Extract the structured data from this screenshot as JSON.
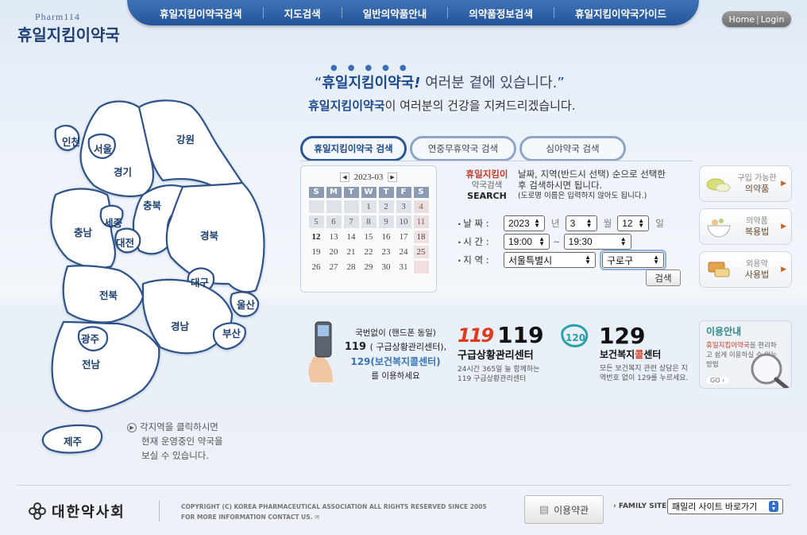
{
  "nav": {
    "items": [
      "휴일지킴이약국검색",
      "지도검색",
      "일반의약품안내",
      "의약품정보검색",
      "휴일지킴이약국가이드"
    ]
  },
  "logo": {
    "sub": "Pharm114",
    "main": "휴일지킴이약국"
  },
  "header": {
    "home": "Home",
    "divider": "|",
    "login": "Login"
  },
  "hero": {
    "line1_quote_open": "“",
    "line1_brand": "휴일지킴이약국",
    "line1_mark": "!",
    "line1_rest": " 여러분 곁에 있습니다.",
    "line1_quote_close": "”",
    "line2_brand": "휴일지킴이약국",
    "line2_rest": "이 여러분의 건강을 지켜드리겠습니다."
  },
  "map": {
    "regions": [
      "인천",
      "서울",
      "경기",
      "강원",
      "충북",
      "세종",
      "충남",
      "대전",
      "경북",
      "대구",
      "전북",
      "울산",
      "경남",
      "부산",
      "광주",
      "전남",
      "제주"
    ],
    "note": [
      "각지역을 클릭하시면",
      "현재 운영중인 약국을",
      "보실 수 있습니다."
    ]
  },
  "tabs": [
    "휴일지킴이약국 검색",
    "연중무휴약국 검색",
    "심야약국 검색"
  ],
  "calendar": {
    "title": "2023-03",
    "prev": "◀",
    "next": "▶",
    "days_of_week": [
      "S",
      "M",
      "T",
      "W",
      "T",
      "F",
      "S"
    ],
    "rows": [
      [
        "",
        "",
        "",
        "1",
        "2",
        "3",
        "4"
      ],
      [
        "5",
        "6",
        "7",
        "8",
        "9",
        "10",
        "11"
      ],
      [
        "12",
        "13",
        "14",
        "15",
        "16",
        "17",
        "18"
      ],
      [
        "19",
        "20",
        "21",
        "22",
        "23",
        "24",
        "25"
      ],
      [
        "26",
        "27",
        "28",
        "29",
        "30",
        "31",
        ""
      ]
    ],
    "today": "12"
  },
  "search": {
    "logo": [
      "휴일지킴이",
      "약국검색",
      "SEARCH"
    ],
    "desc": "날짜, 지역(반드시 선택) 순으로 선택한 후 검색하시면 됩니다.",
    "desc_small": "(도로명 이름은 입력하지 않아도 됩니다.)",
    "date_label": "날 짜 :",
    "year": "2023",
    "year_unit": "년",
    "month": "3",
    "month_unit": "월",
    "day": "12",
    "day_unit": "일",
    "time_label": "시 간 :",
    "time_from": "19:00",
    "time_tilde": "~",
    "time_to": "19:30",
    "region_label": "지 역 :",
    "city": "서울특별시",
    "district": "구로구",
    "button": "검색"
  },
  "side": [
    {
      "small": "구입 가능한",
      "main": "의약품"
    },
    {
      "small": "의약품",
      "main": "복용법"
    },
    {
      "small": "외용약",
      "main": "사용법"
    }
  ],
  "info": {
    "phone": {
      "t1": "국번없이 (핸드폰 동일)",
      "t2a": "119",
      "t2b": "( 구급상황관리센터),",
      "t3": "129(보건복지콜센터)",
      "t4": "를 이용하세요"
    },
    "c119": {
      "logo": "119",
      "num": "119",
      "title": "구급상황관리센터",
      "desc": "24시간 365일 늘 함께하는 119 구급상황관리센터"
    },
    "c129": {
      "logo": "120",
      "num": "129",
      "title_a": "보건복지",
      "title_b": "콜",
      "title_c": "센터",
      "desc": "모든 보건복지 관련 상담은 지역번호 없이 129를 누르세요."
    },
    "usage": {
      "title": "이용안내",
      "brand": "휴일지킴이약국",
      "body": "을 편리하고 쉽게 이용하실 수 있는 방법",
      "go": "GO ›"
    }
  },
  "footer": {
    "org": "대한약사회",
    "copy1": "COPYRIGHT (C) KOREA PHARMACEUTICAL ASSOCIATION ALL RIGHTS RESERVED SINCE 2005",
    "copy2": "FOR MORE INFORMATION CONTACT US.",
    "terms": "이용약관",
    "family_label": "› FAMILY SITE",
    "family_select": "패밀리 사이트 바로가기"
  }
}
